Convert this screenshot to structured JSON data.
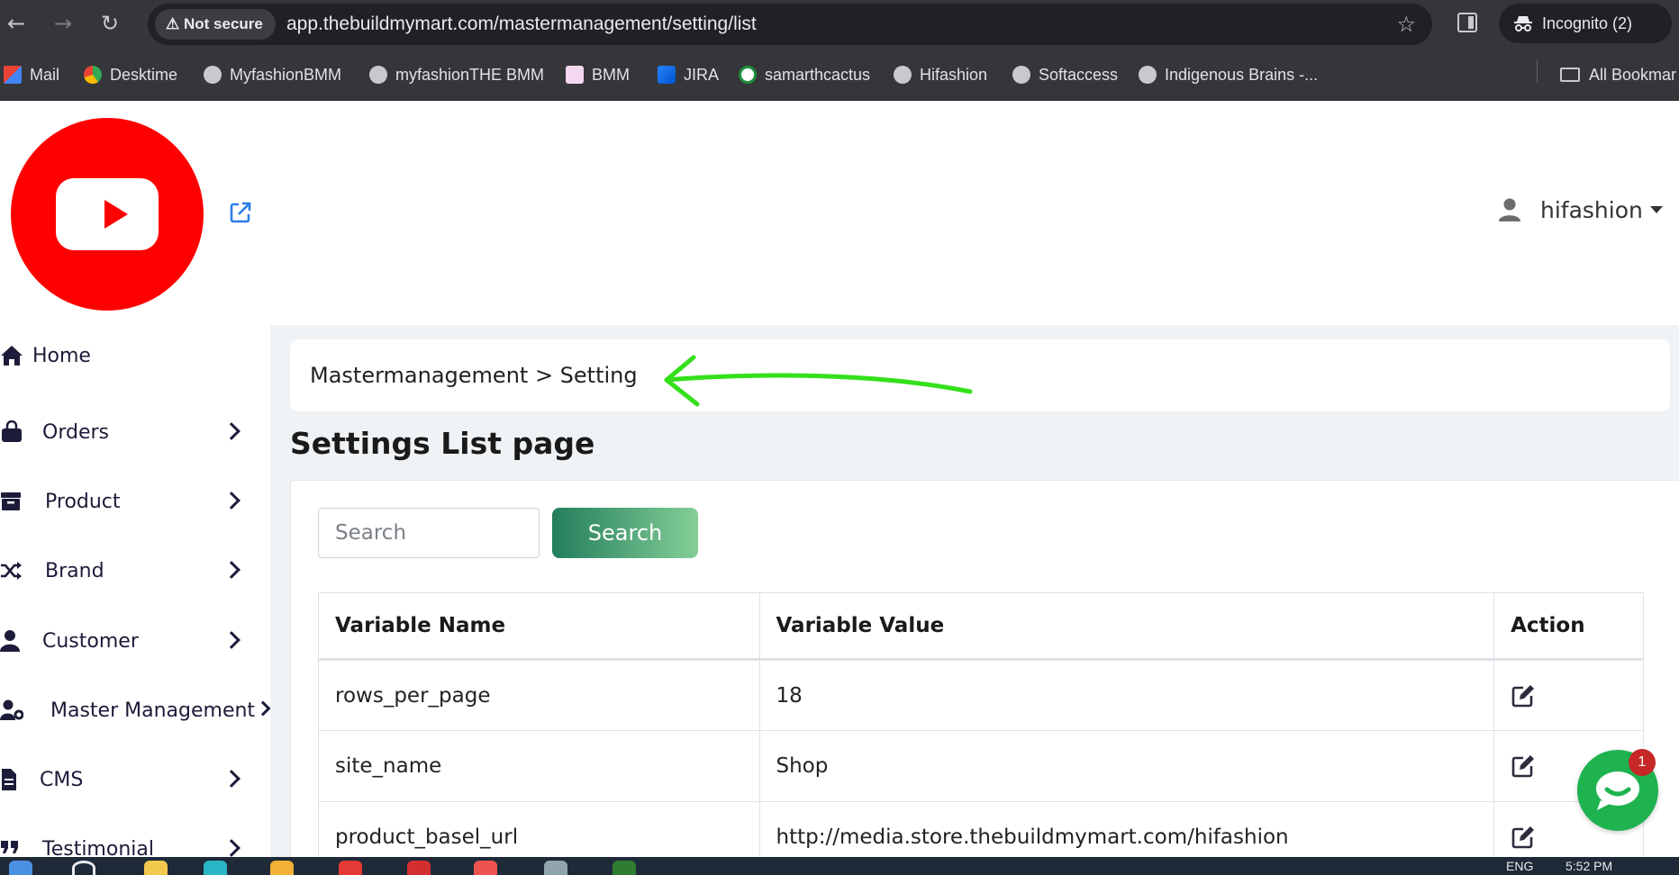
{
  "browser": {
    "security_label": "Not secure",
    "url": "app.thebuildmymart.com/mastermanagement/setting/list",
    "incognito_label": "Incognito (2)",
    "bookmarks": [
      {
        "label": "Mail",
        "icon": "gmail-icon"
      },
      {
        "label": "Desktime",
        "icon": "desktime-icon"
      },
      {
        "label": "MyfashionBMM",
        "icon": "globe-icon"
      },
      {
        "label": "myfashionTHE BMM",
        "icon": "globe-icon"
      },
      {
        "label": "BMM",
        "icon": "bmm-icon"
      },
      {
        "label": "JIRA",
        "icon": "jira-icon"
      },
      {
        "label": "samarthcactus",
        "icon": "cactus-icon"
      },
      {
        "label": "Hifashion",
        "icon": "globe-icon"
      },
      {
        "label": "Softaccess",
        "icon": "globe-icon"
      },
      {
        "label": "Indigenous Brains -...",
        "icon": "globe-icon"
      }
    ],
    "all_bookmarks_label": "All Bookmar"
  },
  "header": {
    "user_name": "hifashion"
  },
  "sidebar": {
    "items": [
      {
        "label": "Home",
        "icon": "home-icon",
        "has_chevron": false
      },
      {
        "label": "Orders",
        "icon": "shopping-bag-icon",
        "has_chevron": true
      },
      {
        "label": "Product",
        "icon": "archive-box-icon",
        "has_chevron": true
      },
      {
        "label": "Brand",
        "icon": "shuffle-icon",
        "has_chevron": true
      },
      {
        "label": "Customer",
        "icon": "user-icon",
        "has_chevron": true
      },
      {
        "label": "Master Management",
        "icon": "user-gear-icon",
        "has_chevron": true
      },
      {
        "label": "CMS",
        "icon": "file-icon",
        "has_chevron": true
      },
      {
        "label": "Testimonial",
        "icon": "quote-icon",
        "has_chevron": true
      }
    ]
  },
  "main": {
    "breadcrumb": "Mastermanagement > Setting",
    "page_title": "Settings List page",
    "search": {
      "placeholder": "Search",
      "button_label": "Search"
    },
    "table": {
      "headers": [
        "Variable Name",
        "Variable Value",
        "Action"
      ],
      "rows": [
        {
          "name": "rows_per_page",
          "value": "18"
        },
        {
          "name": "site_name",
          "value": "Shop"
        },
        {
          "name": "product_basel_url",
          "value": "http://media.store.thebuildmymart.com/hifashion"
        }
      ]
    }
  },
  "chat_widget": {
    "badge_count": "1"
  },
  "taskbar": {
    "language": "ENG",
    "time": "5:52 PM"
  },
  "colors": {
    "accent_green": "#237d5c",
    "annotation_arrow": "#33e01a",
    "logo_red": "#ff0000"
  }
}
